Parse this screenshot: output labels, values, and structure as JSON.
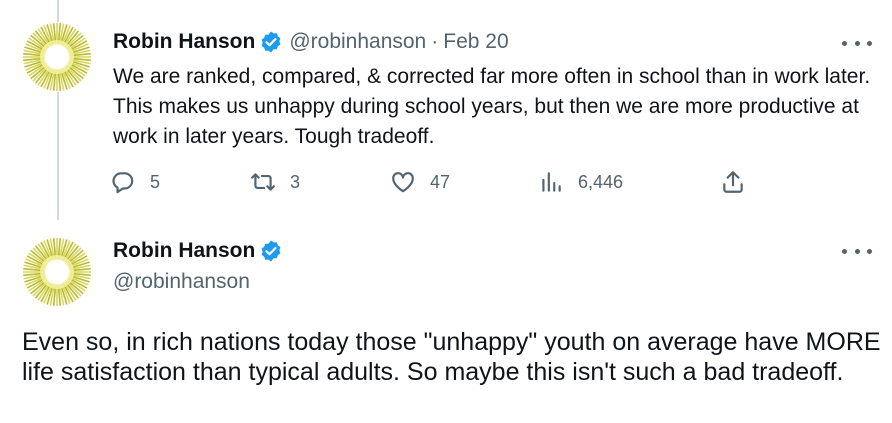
{
  "tweet1": {
    "author_name": "Robin Hanson",
    "handle": "@robinhanson",
    "separator": "·",
    "date": "Feb 20",
    "text": "We are ranked, compared, & corrected far more often in school than in work later. This makes us unhappy during school years, but then we are more productive at work in later years. Tough tradeoff.",
    "replies": "5",
    "retweets": "3",
    "likes": "47",
    "views": "6,446"
  },
  "tweet2": {
    "author_name": "Robin Hanson",
    "handle": "@robinhanson",
    "text": "Even so, in rich nations today those \"unhappy\" youth on average have MORE life satisfaction than typical adults. So maybe this isn't such a bad tradeoff."
  },
  "colors": {
    "verified_blue": "#1d9bf0",
    "secondary_text": "#536471",
    "thread_line": "#cfd9de",
    "avatar_yellow": "#e8e84a"
  },
  "icons": [
    "verified-badge-icon",
    "more-icon",
    "reply-icon",
    "retweet-icon",
    "like-icon",
    "views-icon",
    "share-icon"
  ]
}
